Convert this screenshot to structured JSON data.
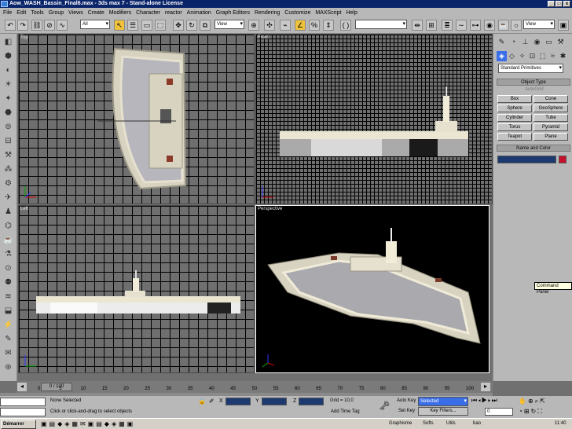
{
  "window": {
    "title": "Aow_WASH_Bassin_Final6.max - 3ds max 7 - Stand-alone License",
    "min": "_",
    "max": "□",
    "close": "x"
  },
  "menu": [
    "File",
    "Edit",
    "Tools",
    "Group",
    "Views",
    "Create",
    "Modifiers",
    "Character",
    "reactor",
    "Animation",
    "Graph Editors",
    "Rendering",
    "Customize",
    "MAXScript",
    "Help"
  ],
  "toolbar": {
    "selection_filter": "All",
    "ref_coord": "View",
    "named_selection": "",
    "render_type": "View"
  },
  "viewports": {
    "top": "Top",
    "front": "Front",
    "left": "Left",
    "perspective": "Perspective"
  },
  "command_panel": {
    "category": "Standard Primitives",
    "object_type_header": "Object Type",
    "autogrid": "AutoGrid",
    "buttons": [
      "Box",
      "Cone",
      "Sphere",
      "GeoSphere",
      "Cylinder",
      "Tube",
      "Torus",
      "Pyramid",
      "Teapot",
      "Plane"
    ],
    "name_color_header": "Name and Color",
    "accent_color": "#c8102e"
  },
  "tooltip": "Command Panel",
  "timeline": {
    "frame_label": "0 / 100",
    "ticks": [
      "0",
      "5",
      "10",
      "15",
      "20",
      "25",
      "30",
      "35",
      "40",
      "45",
      "50",
      "55",
      "60",
      "65",
      "70",
      "75",
      "80",
      "85",
      "90",
      "95",
      "100"
    ]
  },
  "status": {
    "selection": "None Selected",
    "prompt": "Click or click-and-drag to select objects",
    "x_label": "X",
    "y_label": "Y",
    "z_label": "Z",
    "grid": "Grid = 10,0",
    "add_time_tag": "Add Time Tag",
    "auto_key": "Auto Key",
    "selected_combo": "Selected",
    "set_key": "Set Key",
    "key_filters": "Key Filters...",
    "frame": "0"
  },
  "taskbar": {
    "start": "Démarrer",
    "items": [
      "Graphisme",
      "Softs",
      "Utils",
      "bao"
    ],
    "clock": "11:40"
  }
}
